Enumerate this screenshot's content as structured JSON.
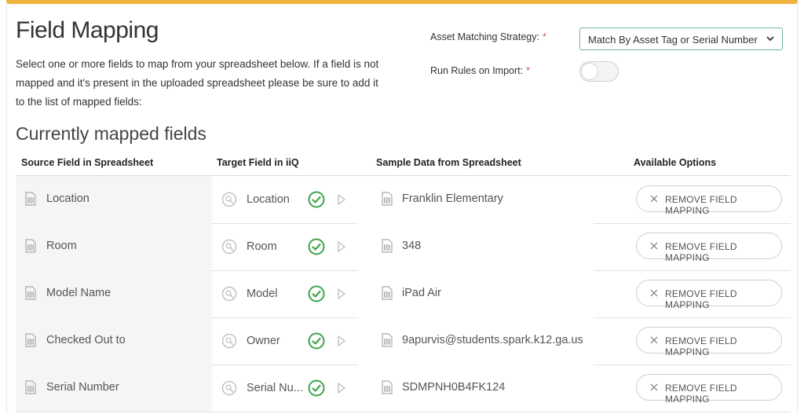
{
  "page": {
    "title": "Field Mapping",
    "description": "Select one or more fields to map from your spreadsheet below. If a field is not mapped and it's present in the uploaded spreadsheet please be sure to add it to the list of mapped fields:",
    "accent_color": "#f0b441"
  },
  "settings": {
    "strategy_label": "Asset Matching Strategy:",
    "strategy_value": "Match By Asset Tag or Serial Number",
    "rules_label": "Run Rules on Import:",
    "rules_enabled": false,
    "required_marker": "*"
  },
  "mapped": {
    "section_title": "Currently mapped fields",
    "columns": {
      "source": "Source Field in Spreadsheet",
      "target": "Target Field in iiQ",
      "sample": "Sample Data from Spreadsheet",
      "options": "Available Options"
    },
    "remove_label": "REMOVE FIELD MAPPING",
    "rows": [
      {
        "source": "Location",
        "target": "Location",
        "sample": "Franklin Elementary"
      },
      {
        "source": "Room",
        "target": "Room",
        "sample": "348"
      },
      {
        "source": "Model Name",
        "target": "Model",
        "sample": "iPad Air"
      },
      {
        "source": "Checked Out to",
        "target": "Owner",
        "sample": "9apurvis@students.spark.k12.ga.us"
      },
      {
        "source": "Serial Number",
        "target": "Serial Nu...",
        "sample": "SDMPNH0B4FK124"
      }
    ]
  },
  "icons": {
    "doc": "spreadsheet-doc-icon",
    "target": "field-target-icon",
    "check": "check-circle-icon",
    "arrow": "chevron-right-icon",
    "remove": "close-icon",
    "select": "chevron-down-icon"
  }
}
